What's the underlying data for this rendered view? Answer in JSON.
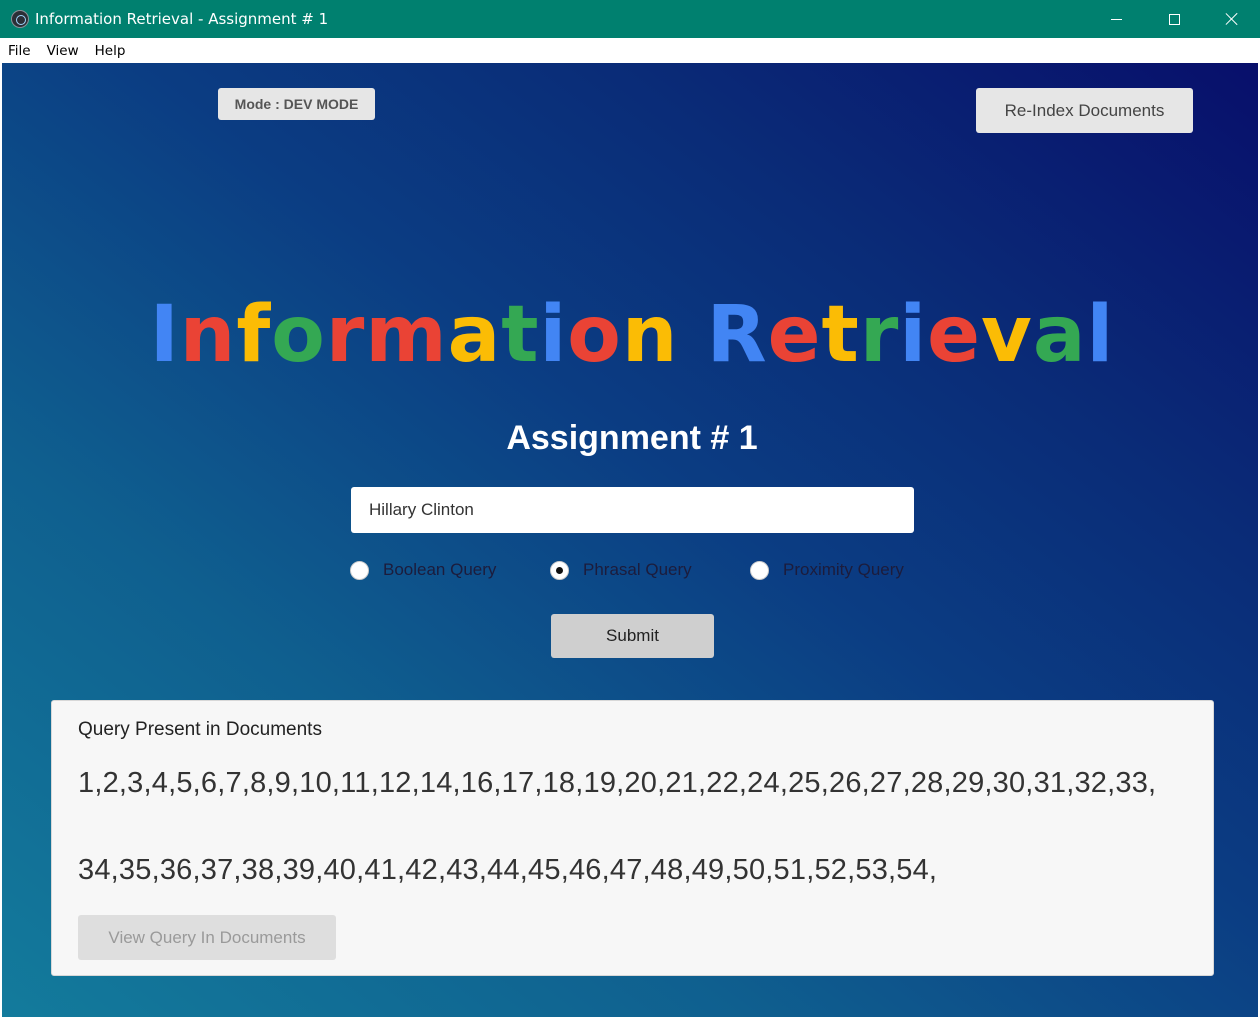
{
  "window": {
    "title": "Information Retrieval - Assignment # 1",
    "icon": "electron-app-icon",
    "controls": [
      "minimize-icon",
      "maximize-icon",
      "close-icon"
    ]
  },
  "menu": {
    "items": [
      "File",
      "View",
      "Help"
    ]
  },
  "header": {
    "mode_label": "Mode : DEV MODE",
    "reindex_label": "Re-Index Documents"
  },
  "hero": {
    "title_letters": [
      {
        "ch": "I",
        "color": "#4285f4"
      },
      {
        "ch": "n",
        "color": "#ea4335"
      },
      {
        "ch": "f",
        "color": "#fbbc05"
      },
      {
        "ch": "o",
        "color": "#34a853"
      },
      {
        "ch": "r",
        "color": "#ea4335"
      },
      {
        "ch": "m",
        "color": "#ea4335"
      },
      {
        "ch": "a",
        "color": "#fbbc05"
      },
      {
        "ch": "t",
        "color": "#34a853"
      },
      {
        "ch": "i",
        "color": "#4285f4"
      },
      {
        "ch": "o",
        "color": "#ea4335"
      },
      {
        "ch": "n",
        "color": "#fbbc05"
      },
      {
        "ch": " ",
        "color": "#ffffff"
      },
      {
        "ch": "R",
        "color": "#4285f4"
      },
      {
        "ch": "e",
        "color": "#ea4335"
      },
      {
        "ch": "t",
        "color": "#fbbc05"
      },
      {
        "ch": "r",
        "color": "#34a853"
      },
      {
        "ch": "i",
        "color": "#4285f4"
      },
      {
        "ch": "e",
        "color": "#ea4335"
      },
      {
        "ch": "v",
        "color": "#fbbc05"
      },
      {
        "ch": "a",
        "color": "#34a853"
      },
      {
        "ch": "l",
        "color": "#4285f4"
      }
    ],
    "subtitle": "Assignment # 1"
  },
  "search": {
    "value": "Hillary Clinton",
    "query_types": [
      {
        "label": "Boolean Query",
        "checked": false
      },
      {
        "label": "Phrasal Query",
        "checked": true
      },
      {
        "label": "Proximity Query",
        "checked": false
      }
    ],
    "submit_label": "Submit"
  },
  "results": {
    "heading": "Query Present in Documents",
    "line1": "1,2,3,4,5,6,7,8,9,10,11,12,14,16,17,18,19,20,21,22,24,25,26,27,28,29,30,31,32,33,",
    "line2": "34,35,36,37,38,39,40,41,42,43,44,45,46,47,48,49,50,51,52,53,54,",
    "view_label": "View Query In Documents"
  }
}
